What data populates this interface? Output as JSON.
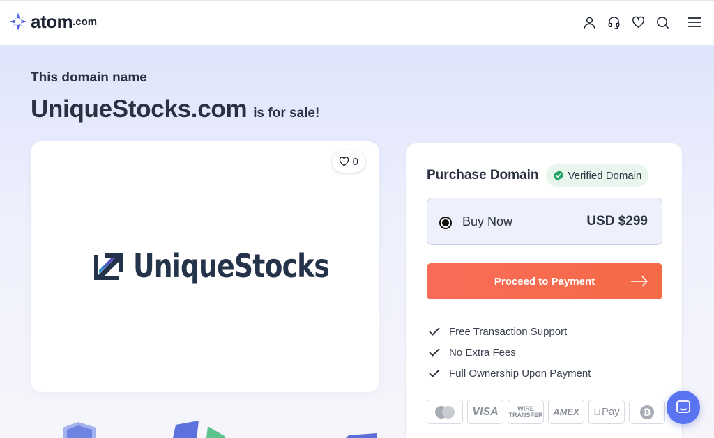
{
  "header": {
    "logo_text": "atom",
    "logo_tld": ".com",
    "icons": [
      "user-icon",
      "headset-icon",
      "heart-icon",
      "search-icon",
      "menu-icon"
    ]
  },
  "hero": {
    "eyebrow": "This domain name",
    "domain": "UniqueStocks.com",
    "for_sale": "is for sale!"
  },
  "logo_card": {
    "like_count": "0",
    "brand_name": "UniqueStocks"
  },
  "purchase": {
    "title": "Purchase Domain",
    "verified_label": "Verified Domain",
    "option_label": "Buy Now",
    "option_price": "USD $299",
    "proceed_label": "Proceed to Payment",
    "benefits": [
      "Free Transaction Support",
      "No Extra Fees",
      "Full Ownership Upon Payment"
    ],
    "payment_methods": [
      "Mastercard",
      "VISA",
      "WIRE TRANSFER",
      "AMEX",
      "Apple Pay",
      "Bitcoin"
    ]
  },
  "colors": {
    "accent": "#f46a45",
    "brand_blue": "#5a73f0",
    "verified_green": "#1fa463",
    "text_dark": "#2a3140"
  }
}
